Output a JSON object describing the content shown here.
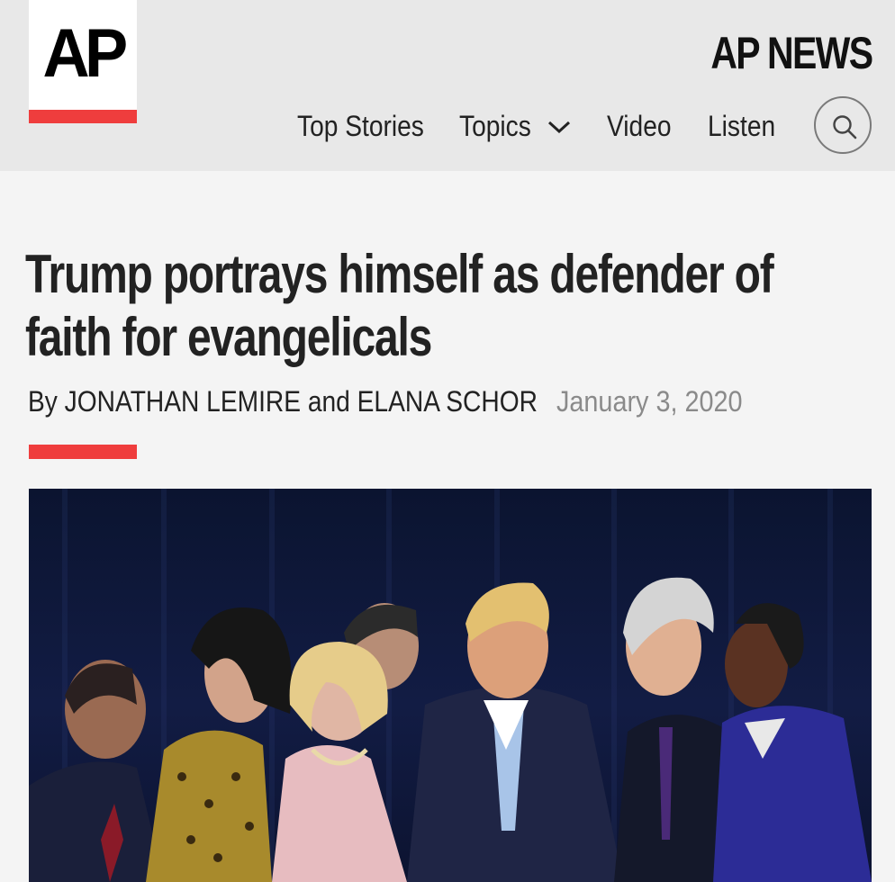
{
  "header": {
    "logo_text": "AP",
    "brand": "AP NEWS",
    "nav": {
      "top_stories": "Top Stories",
      "topics": "Topics",
      "video": "Video",
      "listen": "Listen"
    }
  },
  "article": {
    "headline": "Trump portrays himself as defender of faith for evangelicals",
    "byline_prefix": "By",
    "authors": "JONATHAN LEMIRE and ELANA SCHOR",
    "date": "January 3, 2020"
  },
  "colors": {
    "accent": "#ef3d3d",
    "header_bg": "#e8e8e8",
    "page_bg": "#f4f4f4"
  },
  "icons": [
    "chevron-down-icon",
    "search-icon"
  ]
}
